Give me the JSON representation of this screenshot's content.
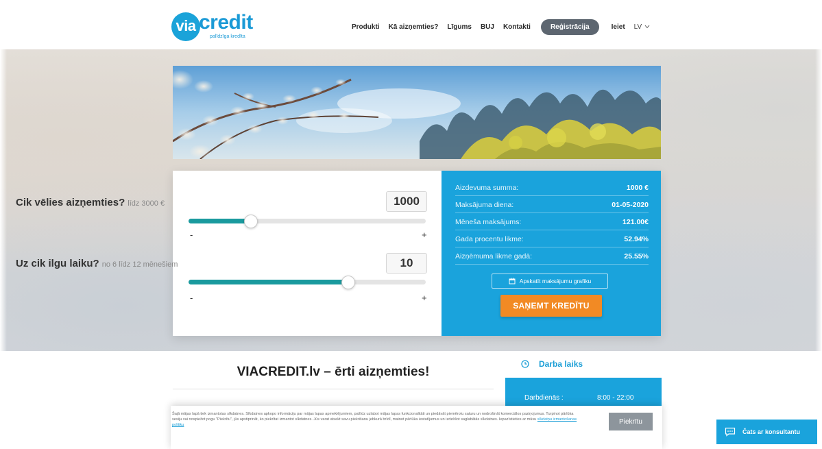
{
  "header": {
    "logo_via": "via",
    "logo_word": "credit",
    "logo_tagline": "palīdzīga kredīta",
    "nav": [
      "Produkti",
      "Kā aizņemties?",
      "Līgums",
      "BUJ",
      "Kontakti"
    ],
    "register_label": "Reģistrācija",
    "login_label": "Ieiet",
    "language": "LV"
  },
  "calculator": {
    "amount_question": "Cik vēlies aizņemties?",
    "amount_hint": "līdz 3000 €",
    "amount_value": "1000",
    "amount_slider_fraction": 0.26,
    "term_question": "Uz cik ilgu laiku?",
    "term_hint": "no 6 līdz 12 mēnešiem",
    "term_value": "10",
    "term_slider_fraction": 0.67,
    "minus": "-",
    "plus": "+"
  },
  "summary": {
    "rows": [
      {
        "label": "Aizdevuma summa:",
        "value": "1000 €"
      },
      {
        "label": "Maksājuma diena:",
        "value": "01-05-2020"
      },
      {
        "label": "Mēneša maksājums:",
        "value": "121.00€"
      },
      {
        "label": "Gada procentu likme:",
        "value": "52.94%"
      },
      {
        "label": "Aizņēmuma likme gadā:",
        "value": "25.55%"
      }
    ],
    "schedule_label": "Apskatīt maksājumu grafiku",
    "cta_label": "SAŅEMT KREDĪTU"
  },
  "content": {
    "headline": "VIACREDIT.lv – ērti aizņemties!",
    "work_title": "Darba laiks",
    "work_day": "Darbdienās :",
    "work_hours": "8:00 - 22:00"
  },
  "cookie": {
    "text": "Šajā mājas lapā tiek izmantotas sīkdatnes. Sīkdatnes apkopo informāciju par mājas lapas apmeklējumiem, pašīdz uzlabot mājas lapas funkcionalitāti un piedāvāt piemērotu saturu un nodrošināt komerciālos paziņojumus. Turpinot pārlūka sesiju vai nospiežot pogu \"Piekrītu\", jūs apstiprināt, ko piekrītat izmantot sīkdatnes. Jūs varat atsekt savu piekrišanu jebkurā brīdī, mainot pārlūka iestatījumus un izdzēšot saglabātās sīkdatnes. Iepazīstieties ar mūsu",
    "link": "sīkdatņu izmantošanas politiku",
    "accept_label": "Piekrītu"
  },
  "chat": {
    "label": "Čats ar konsultantu"
  },
  "colors": {
    "brand_blue": "#1aa3dc",
    "cta_orange": "#f28a24",
    "slider_teal": "#1a9a9e",
    "register_gray": "#5d6670"
  }
}
